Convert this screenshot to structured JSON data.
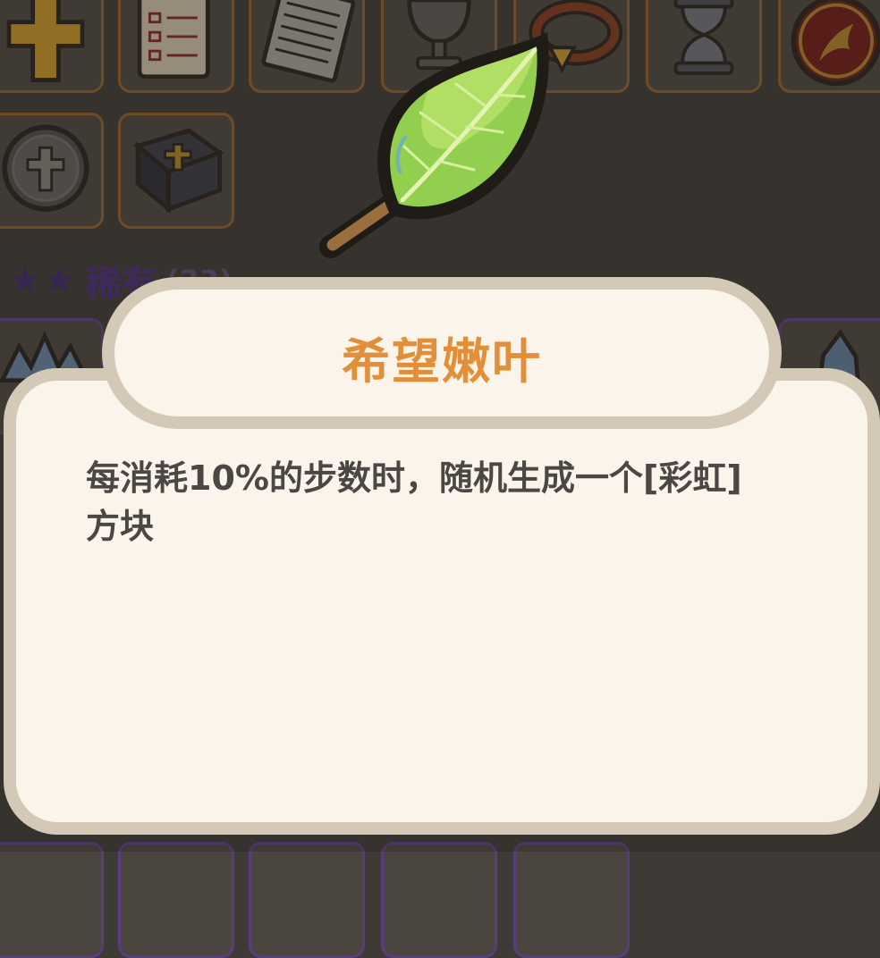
{
  "background": {
    "rarity_header": {
      "stars": "★★",
      "name": "稀有",
      "count": "(33)"
    },
    "top_row_items": [
      "cross-icon",
      "checklist-icon",
      "receipt-icon",
      "chalice-icon",
      "ring-icon",
      "hourglass-icon",
      "phoenix-emblem-icon"
    ],
    "second_row_items": [
      "cross-medallion-icon",
      "bible-icon"
    ],
    "rare_row_items": [
      "ice-crown-icon",
      "crystal-icon"
    ]
  },
  "item": {
    "icon": "leaf-icon",
    "name": "希望嫩叶",
    "description": "每消耗10%的步数时，随机生成一个[彩虹]方块"
  },
  "colors": {
    "title": "#e28f3a",
    "panel": "#fbf4ea",
    "panel_border": "#d4c8b6",
    "text": "#4a4744"
  }
}
